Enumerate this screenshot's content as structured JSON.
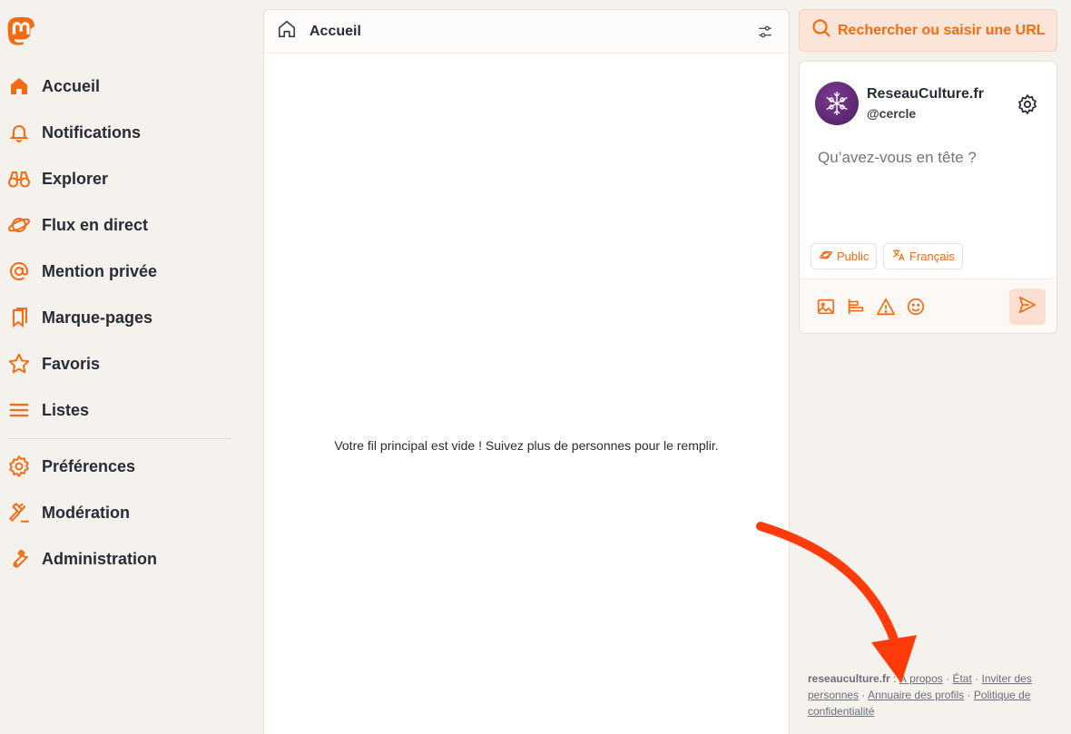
{
  "nav": {
    "items": [
      {
        "label": "Accueil",
        "icon": "home-icon"
      },
      {
        "label": "Notifications",
        "icon": "bell-icon"
      },
      {
        "label": "Explorer",
        "icon": "binoculars-icon"
      },
      {
        "label": "Flux en direct",
        "icon": "planet-icon"
      },
      {
        "label": "Mention privée",
        "icon": "at-icon"
      },
      {
        "label": "Marque-pages",
        "icon": "bookmarks-icon"
      },
      {
        "label": "Favoris",
        "icon": "star-icon"
      },
      {
        "label": "Listes",
        "icon": "list-icon"
      },
      {
        "label": "Préférences",
        "icon": "gear-icon"
      },
      {
        "label": "Modération",
        "icon": "gavel-icon"
      },
      {
        "label": "Administration",
        "icon": "wrench-icon"
      }
    ]
  },
  "main": {
    "title": "Accueil",
    "empty_message": "Votre fil principal est vide ! Suivez plus de personnes pour le remplir."
  },
  "search": {
    "placeholder": "Rechercher ou saisir une URL"
  },
  "compose": {
    "account_name": "ReseauCulture.fr",
    "account_handle": "@cercle",
    "placeholder": "Qu’avez-vous en tête ?",
    "visibility_label": "Public",
    "language_label": "Français"
  },
  "footer": {
    "brand": "reseauculture.fr",
    "links": {
      "about": "À propos",
      "status": "État",
      "invite": "Inviter des personnes",
      "directory": "Annuaire des profils",
      "privacy": "Politique de confidentialité"
    }
  },
  "colors": {
    "accent": "#f56b12",
    "background": "#f5f1ec",
    "annotation_arrow": "#ff3b0a"
  }
}
